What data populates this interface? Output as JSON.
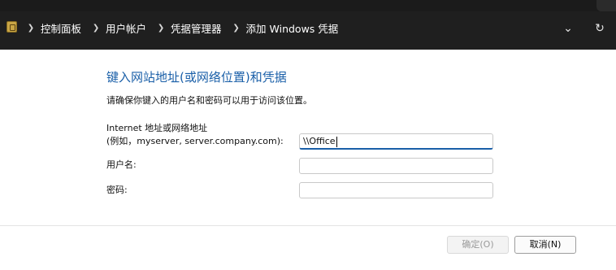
{
  "breadcrumb": {
    "items": [
      "控制面板",
      "用户帐户",
      "凭据管理器",
      "添加 Windows 凭据"
    ]
  },
  "icons": {
    "app": "control-panel-icon",
    "separator": "chevron-right-icon",
    "dropdown": "chevron-down-icon",
    "refresh": "refresh-icon"
  },
  "form": {
    "heading": "键入网站地址(或网络位置)和凭据",
    "subtext": "请确保你键入的用户名和密码可以用于访问该位置。",
    "address_label_line1": "Internet 地址或网络地址",
    "address_label_line2": "(例如，myserver, server.company.com):",
    "address_value": "\\\\Office",
    "username_label": "用户名:",
    "username_value": "",
    "password_label": "密码:",
    "password_value": ""
  },
  "buttons": {
    "ok": "确定(O)",
    "cancel": "取消(N)"
  },
  "colors": {
    "heading": "#1a5fa8",
    "titlebar": "#1f1f1f"
  }
}
